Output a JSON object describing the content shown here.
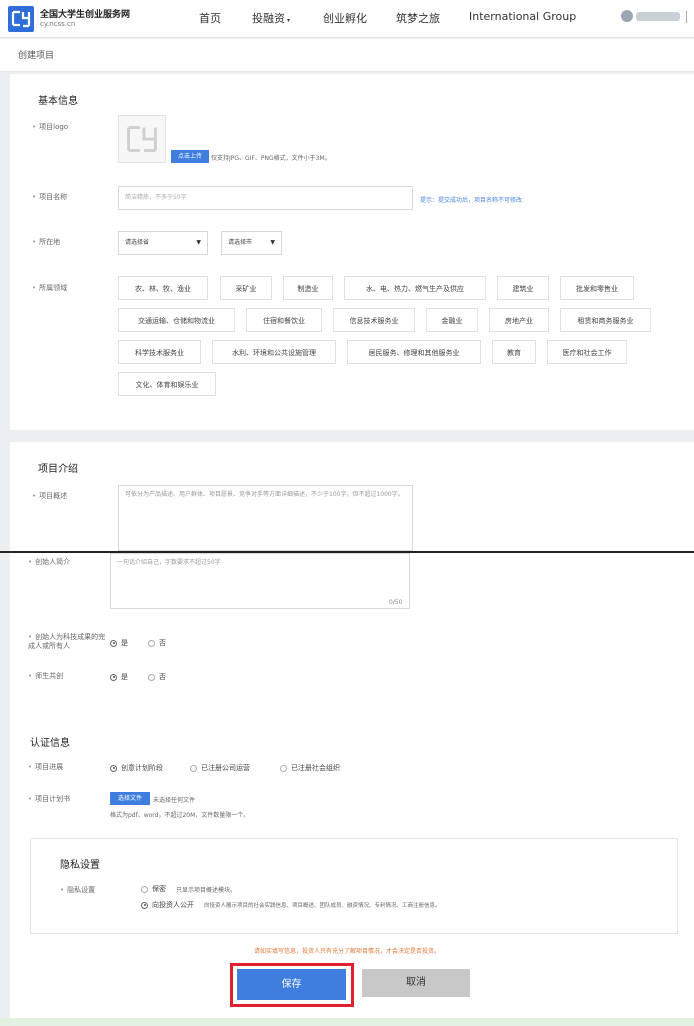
{
  "header": {
    "site_name": "全国大学生创业服务网",
    "site_url": "cy.ncss.cn",
    "nav": [
      "首页",
      "投融资",
      "创业孵化",
      "筑梦之旅",
      "International Group"
    ],
    "nav_caret": "▾",
    "user_sep": ""
  },
  "breadcrumb": "创建项目",
  "basic": {
    "title": "基本信息",
    "logo_label": "项目logo",
    "upload_button": "点击上传",
    "upload_hint": "仅支持JPG、GIF、PNG格式，文件小于3M。",
    "name_label": "项目名称",
    "name_placeholder": "简洁精炼，不多于50字",
    "name_hint": "提示：提交成功后，项目名称不可修改",
    "location_label": "所在地",
    "province_placeholder": "请选择省",
    "city_placeholder": "请选择市",
    "field_label": "所属领域",
    "fields": [
      "农、林、牧、渔业",
      "采矿业",
      "制造业",
      "水、电、热力、燃气生产及供应",
      "建筑业",
      "批发和零售业",
      "交通运输、仓储和物流业",
      "住宿和餐饮业",
      "信息技术服务业",
      "金融业",
      "房地产业",
      "租赁和商务服务业",
      "科学技术服务业",
      "水利、环境和公共设施管理",
      "居民服务、修理和其他服务业",
      "教育",
      "医疗和社会工作",
      "文化、体育和娱乐业"
    ]
  },
  "intro": {
    "title": "项目介绍",
    "overview_label": "项目概述",
    "overview_placeholder": "可依分为产品描述、用户群体、项目愿景、竞争对手等方面详细描述，不少于100字，但不超过1000字。",
    "founder_label": "创始人简介",
    "founder_placeholder": "一句话介绍自己，字数要求不超过50字",
    "founder_counter": "0/50",
    "tech_label": "创始人为科技成果的完成人或所有人",
    "tech_yes": "是",
    "tech_no": "否",
    "cocreate_label": "师生共创",
    "cocreate_yes": "是",
    "cocreate_no": "否"
  },
  "auth": {
    "title": "认证信息",
    "progress_label": "项目进展",
    "progress_options": [
      "创意计划阶段",
      "已注册公司运营",
      "已注册社会组织"
    ],
    "plan_label": "项目计划书",
    "choose_file": "选择文件",
    "no_file": "未选择任何文件",
    "file_hint": "格式为pdf、word，不超过20M，文件数量限一个。"
  },
  "privacy": {
    "title": "隐私设置",
    "label": "隐私设置",
    "option1_title": "保密",
    "option1_desc": "只显示项目概述模块。",
    "option2_title": "向投资人公开",
    "option2_desc": "向投资人展示项目的社会实践信息、项目概述、团队成员、融资情况、专利情况、工商注册信息。"
  },
  "warning": "请如实填写信息，投资人只有充分了解项目情况，才会决定是否投资。",
  "actions": {
    "save": "保存",
    "cancel": "取消"
  },
  "colors": {
    "primary": "#3f7ddf",
    "highlight": "#e0202e",
    "warning": "#e2783a"
  }
}
